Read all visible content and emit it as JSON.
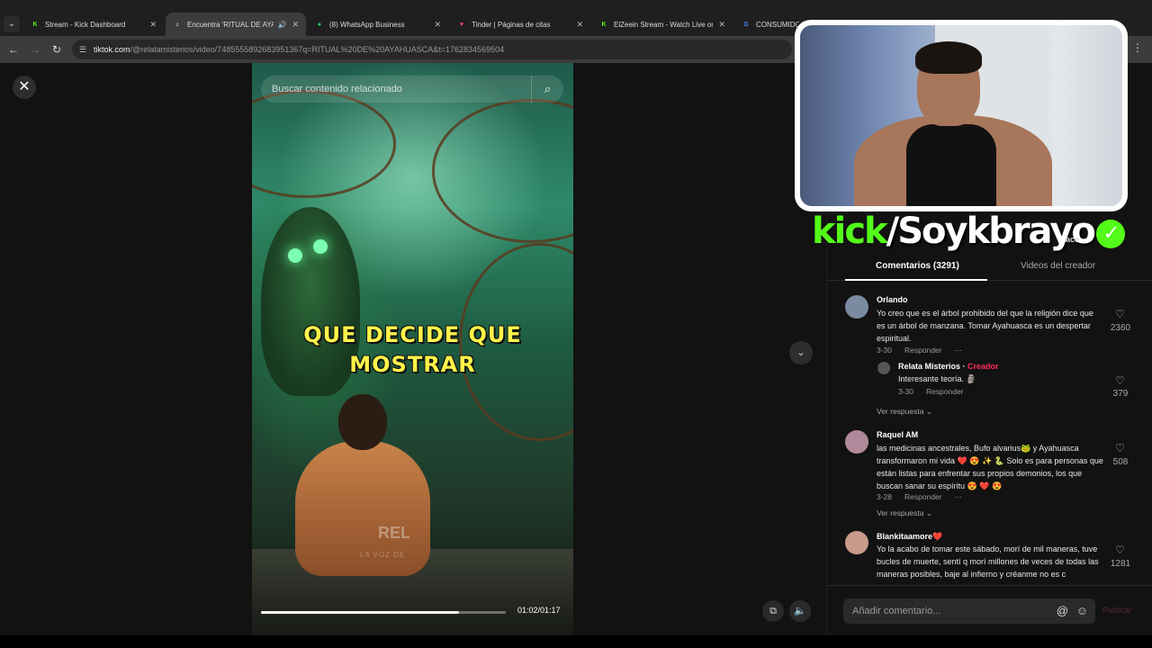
{
  "browser": {
    "tabs": [
      {
        "title": "Stream - Kick Dashboard",
        "color": "#53fc18",
        "glyph": "K"
      },
      {
        "title": "Encuentra 'RITUAL DE AYAHUASCA'",
        "color": "#ffffff",
        "glyph": "♪",
        "active": true
      },
      {
        "title": "(8) WhatsApp Business",
        "color": "#25d366",
        "glyph": "✆"
      },
      {
        "title": "Tinder | Páginas de citas",
        "color": "#fe3c72",
        "glyph": "♥"
      },
      {
        "title": "ElZeein Stream - Watch Live on Kick",
        "color": "#53fc18",
        "glyph": "K"
      },
      {
        "title": "CONSUMIDOR",
        "color": "#4285f4",
        "glyph": "G"
      }
    ],
    "url_host": "tiktok.com",
    "url_path": "/@relatamisterios/video/7485555892683951367q=RITUAL%20DE%20AYAHUASCA&t=1762834569504"
  },
  "video": {
    "search_placeholder": "Buscar contenido relacionado",
    "caption_line1": "QUE DECIDE QUE",
    "caption_line2": "MOSTRAR",
    "watermark": "REL",
    "watermark_sub": "LA VOZ DE",
    "time": "01:02/01:17",
    "progress": 0.81
  },
  "panel": {
    "tab_comments": "Comentarios (3291)",
    "tab_videos": "Videos del creador",
    "comments": [
      {
        "name": "Orlando",
        "text": "Yo creo que es el árbol prohibido del que la religión dice que es un árbol de manzana. Tomar Ayahuasca es un despertar espiritual.",
        "date": "3-30",
        "reply": "Responder",
        "likes": "2360",
        "avatar_color": "#7a8aa0"
      },
      {
        "name": "Relata Misterios",
        "creator_label": "Creador",
        "text": "Interesante teoría. 🗿",
        "date": "3-30",
        "reply": "Responder",
        "likes": "379",
        "avatar_color": "#555555"
      },
      {
        "name": "Raquel AM",
        "text": "las medicinas ancestrales, Bufo alvarius🐸 y Ayahuasca transformaron mi vida ❤️ 😍 ✨ 🐍 Solo es para personas que están listas para enfrentar sus propios demonios, los que buscan sanar su espíritu 😍 ❤️ 😍",
        "date": "3-28",
        "reply": "Responder",
        "likes": "508",
        "avatar_color": "#b08a9a"
      },
      {
        "name": "Blankitaamore❤️",
        "text": "Yo la acabo de tomar este sábado, morí de mil maneras, tuve bucles de muerte, sentí q morí millones de veces de todas las maneras posibles, baje al infierno y créanme no es c",
        "likes": "1281",
        "avatar_color": "#c89a8a"
      }
    ],
    "ver_respuesta": "Ver respuesta ⌄",
    "ver_respuesta2": "Ver respuesta ⌄",
    "comment_placeholder": "Añadir comentario...",
    "publish": "Publicar"
  },
  "overlay": {
    "kick": "kick",
    "handle": "/Soykbrayo",
    "peek": "ace"
  }
}
